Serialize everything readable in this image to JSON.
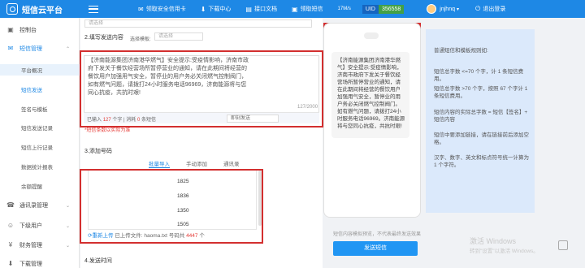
{
  "app": {
    "name": "短信云平台"
  },
  "topnav": [
    {
      "icon": "✉",
      "label": "领取安全信用卡"
    },
    {
      "icon": "⬇",
      "label": "下载中心"
    },
    {
      "icon": "▤",
      "label": "接口文档"
    },
    {
      "icon": "▣",
      "label": "领取短信"
    }
  ],
  "speed": "17M/s",
  "uid": {
    "label": "UID",
    "value": "356558"
  },
  "user": {
    "name": "jnjhnq",
    "logout": "退出登录"
  },
  "sidebar": {
    "items": [
      {
        "label": "控制台",
        "icon": "▣"
      },
      {
        "label": "短信管理",
        "icon": "✉"
      },
      {
        "label": "通讯录管理",
        "icon": "☎"
      },
      {
        "label": "下级用户",
        "icon": "☺"
      },
      {
        "label": "财务管理",
        "icon": "¥"
      },
      {
        "label": "下载管理",
        "icon": "⬇"
      }
    ],
    "subitems": [
      "平台概况",
      "短信发送",
      "签名与模板",
      "短信发送记录",
      "短信上行记录",
      "数据统计报表",
      "余额提醒"
    ]
  },
  "form": {
    "top_select": "请选择",
    "section2": "2.填写发送内容",
    "template_label": "选择模板:",
    "template_select": "请选择",
    "message": "【济南能源集团济南港华燃气】安全提示:受疫情影响，济南市政府下发关于餐饮经营场所暂停营业的通知，请在此期间将经营的餐饮用户加强用气安全，暂停业的用户务必关闭燃气控制阀门，如有燃气问题，请拨打24小时服务电话96969，济南能源将与您同心抗疫，共抗时艰!",
    "counter": "127/2000",
    "entered_prefix": "已输入",
    "entered_count": "127",
    "entered_mid": "个字 | 消耗",
    "consume_count": "0",
    "entered_suffix": "条短信",
    "send_select": "即刻发送",
    "warning": "*短信条数以实际为准",
    "section3": "3.添加号码",
    "tabs": [
      "批量导入",
      "手动添加",
      "通讯录"
    ],
    "numbers": [
      "1825",
      "1836",
      "1350",
      "1505"
    ],
    "upload_btn": "重新上传",
    "upload_text": "已上传文件:",
    "file": "haoma.txt",
    "count_prefix": "号码共",
    "count": "4447",
    "count_suffix": "个",
    "section4": "4.发送时间"
  },
  "preview": {
    "text": "【济南能源集团济南港华燃气】安全提示:受疫情影响，济南市政府下发关于餐饮经营场所暂停营业的通知，请在此期间将经营的餐饮用户加强用气安全，暂停业的用户务必关闭燃气控制阀门。如有燃气问题，请拨打24小时服务电话96969。济南能源将与您同心抗疫，共抗时艰!",
    "note": "短信内容模拟预览，不代表最终发送效果",
    "send_button": "发送短信"
  },
  "tips": {
    "title": "普通短信和模板规则如:",
    "lines": [
      "短信总字数 <=70 个字，计 1 条短信费用。",
      "短信总字数 >70 个字，按照 67 个字计 1 条短信费用。",
      "短信内容的实际总字数 = 短信【签名】+ 短信内容",
      "短信中要添加链接，请在链接前后添加空格。",
      "汉字、数字、英文和标点符号统一计算为 1 个字符。"
    ]
  },
  "watermark": {
    "title": "激活 Windows",
    "subtitle": "转到\"设置\"以激活 Windows。"
  },
  "colors": {
    "topbar": "#1e88e5",
    "accent": "#2196f3",
    "highlight": "#d32f2f"
  }
}
